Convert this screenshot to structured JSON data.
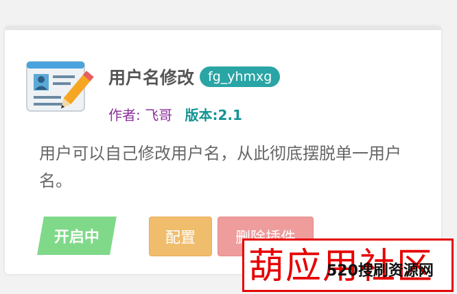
{
  "plugin": {
    "icon": "id-card-pencil-icon",
    "title": "用户名修改",
    "slug": "fg_yhmxg",
    "author": "作者: 飞哥",
    "version": "版本:2.1",
    "description": "用户可以自己修改用户名，从此彻底摆脱单一用户名。",
    "status": "开启中",
    "config_label": "配置",
    "delete_label": "删除插件"
  },
  "watermark": {
    "big_text": "葫应用社区",
    "small_text": "520搜刷资源网"
  },
  "colors": {
    "slug_badge": "#2aa5a5",
    "author": "#8b2f9b",
    "version": "#149494",
    "status": "#7fd989",
    "config_button": "#f0bd6d",
    "delete_button": "#ee9c9c",
    "watermark": "#e60000"
  }
}
